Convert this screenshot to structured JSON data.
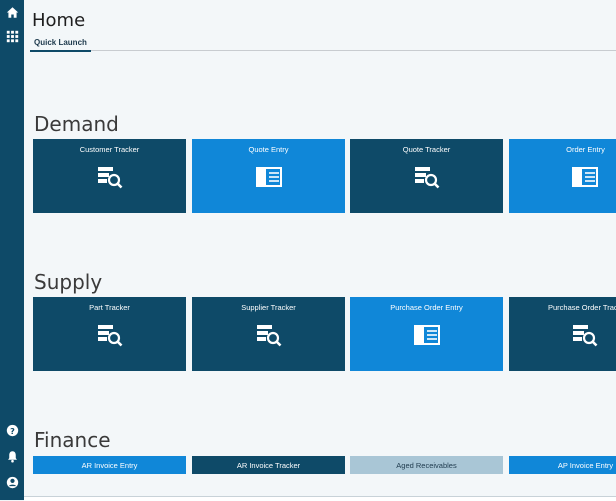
{
  "sidebar": {
    "top_icons": [
      "home-icon",
      "app-grid-icon"
    ],
    "bottom_icons": [
      "help-icon",
      "notifications-icon",
      "user-account-icon"
    ]
  },
  "header": {
    "title": "Home"
  },
  "tabs": [
    {
      "label": "Quick Launch",
      "active": true
    }
  ],
  "sections": [
    {
      "title": "Demand",
      "tiles": [
        {
          "label": "Customer Tracker",
          "style": "dark",
          "icon": "tracker-search-icon"
        },
        {
          "label": "Quote Entry",
          "style": "blue",
          "icon": "entry-form-icon"
        },
        {
          "label": "Quote Tracker",
          "style": "dark",
          "icon": "tracker-search-icon"
        },
        {
          "label": "Order Entry",
          "style": "blue",
          "icon": "entry-form-icon"
        }
      ]
    },
    {
      "title": "Supply",
      "tiles": [
        {
          "label": "Part Tracker",
          "style": "dark",
          "icon": "tracker-search-icon"
        },
        {
          "label": "Supplier Tracker",
          "style": "dark",
          "icon": "tracker-search-icon"
        },
        {
          "label": "Purchase Order Entry",
          "style": "blue",
          "icon": "entry-form-icon"
        },
        {
          "label": "Purchase Order Track",
          "style": "dark",
          "icon": "tracker-search-icon"
        }
      ]
    },
    {
      "title": "Finance",
      "tiles": [
        {
          "label": "AR Invoice Entry",
          "style": "blue"
        },
        {
          "label": "AR Invoice Tracker",
          "style": "dark"
        },
        {
          "label": "Aged Receivables",
          "style": "gray"
        },
        {
          "label": "AP Invoice Entry",
          "style": "blue"
        }
      ]
    }
  ],
  "colors": {
    "sidebar": "#0e4a68",
    "tile_dark": "#0e4a68",
    "tile_blue": "#1087d8",
    "tile_gray": "#a9c6d6"
  }
}
